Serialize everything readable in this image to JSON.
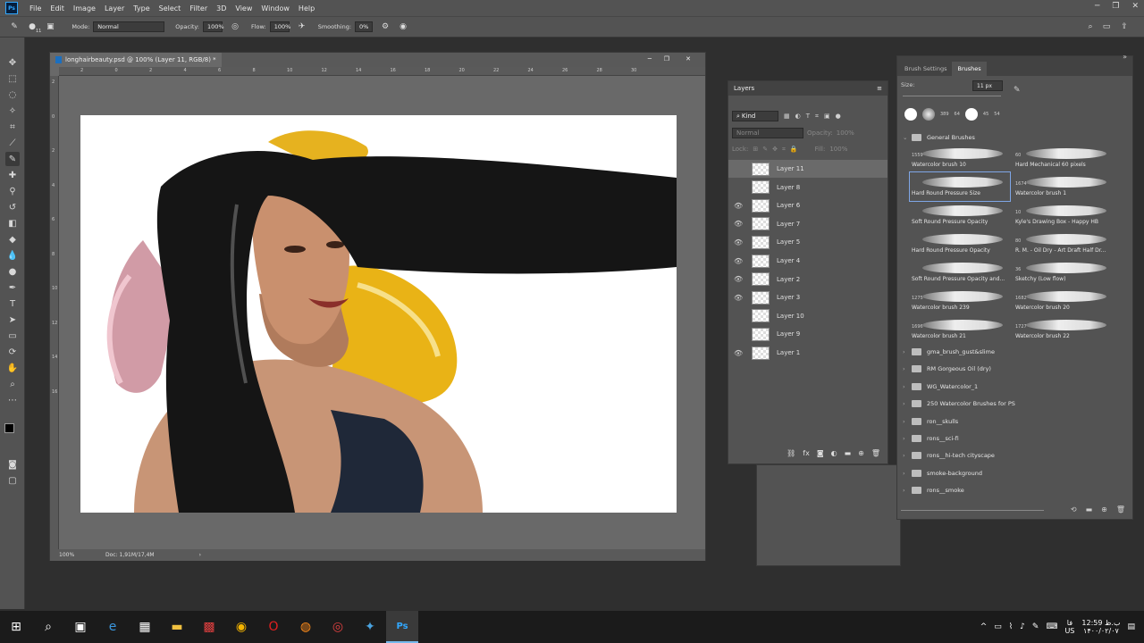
{
  "menu": [
    "File",
    "Edit",
    "Image",
    "Layer",
    "Type",
    "Select",
    "Filter",
    "3D",
    "View",
    "Window",
    "Help"
  ],
  "options": {
    "mode_label": "Mode:",
    "mode_value": "Normal",
    "opacity_label": "Opacity:",
    "opacity_value": "100%",
    "flow_label": "Flow:",
    "flow_value": "100%",
    "smoothing_label": "Smoothing:",
    "smoothing_value": "0%",
    "brush_size": "11"
  },
  "document": {
    "title": "longhairbeauty.psd @ 100% (Layer 11, RGB/8) *",
    "zoom": "100%",
    "doc_info": "Doc: 1,91M/17,4M",
    "ruler_h": [
      "2",
      "0",
      "2",
      "4",
      "6",
      "8",
      "10",
      "12",
      "14",
      "16",
      "18",
      "20",
      "22",
      "24",
      "26",
      "28",
      "30"
    ],
    "ruler_v": [
      "2",
      "0",
      "2",
      "4",
      "6",
      "8",
      "10",
      "12",
      "14",
      "16"
    ]
  },
  "layers": {
    "title": "Layers",
    "filter_kind": "Kind",
    "blend": "Normal",
    "opacity_label": "Opacity:",
    "opacity_value": "100%",
    "lock_label": "Lock:",
    "fill_label": "Fill:",
    "fill_value": "100%",
    "items": [
      {
        "name": "Layer 11",
        "visible": false,
        "selected": true
      },
      {
        "name": "Layer 8",
        "visible": false,
        "selected": false
      },
      {
        "name": "Layer 6",
        "visible": true,
        "selected": false
      },
      {
        "name": "Layer 7",
        "visible": true,
        "selected": false
      },
      {
        "name": "Layer 5",
        "visible": true,
        "selected": false
      },
      {
        "name": "Layer 4",
        "visible": true,
        "selected": false
      },
      {
        "name": "Layer 2",
        "visible": true,
        "selected": false
      },
      {
        "name": "Layer 3",
        "visible": true,
        "selected": false
      },
      {
        "name": "Layer 10",
        "visible": false,
        "selected": false
      },
      {
        "name": "Layer 9",
        "visible": false,
        "selected": false
      },
      {
        "name": "Layer 1",
        "visible": true,
        "selected": false
      }
    ]
  },
  "brushes": {
    "tab_settings": "Brush Settings",
    "tab_brushes": "Brushes",
    "size_label": "Size:",
    "size_value": "11 px",
    "preset_sizes": [
      "389",
      "64",
      "45",
      "54"
    ],
    "group": "General Brushes",
    "items": [
      {
        "name": "Watercolor brush 10",
        "num": "1559"
      },
      {
        "name": "Hard Mechanical 60 pixels",
        "num": "60"
      },
      {
        "name": "Hard Round Pressure Size",
        "num": ""
      },
      {
        "name": "Watercolor brush 1",
        "num": "1674"
      },
      {
        "name": "Soft Round Pressure Opacity",
        "num": ""
      },
      {
        "name": "Kyle's Drawing Box - Happy HB",
        "num": "10"
      },
      {
        "name": "Hard Round Pressure Opacity",
        "num": ""
      },
      {
        "name": "R. M. - Oil Dry - Art Draft Half Dr...",
        "num": "80"
      },
      {
        "name": "Soft Round Pressure Opacity and...",
        "num": ""
      },
      {
        "name": "Sketchy (Low flow)",
        "num": "36"
      },
      {
        "name": "Watercolor brush 239",
        "num": "1275"
      },
      {
        "name": "Watercolor brush 20",
        "num": "1682"
      },
      {
        "name": "Watercolor brush 21",
        "num": "1696"
      },
      {
        "name": "Watercolor brush 22",
        "num": "1727"
      }
    ],
    "folders": [
      "gma_brush_gust&slime",
      "RM Gorgeous Oil (dry)",
      "WG_Watercolor_1",
      "250 Watercolor Brushes for PS",
      "ron__skulls",
      "rons__sci-fi",
      "rons__hi-tech cityscape",
      "smoke-background",
      "rons__smoke"
    ]
  },
  "taskbar": {
    "time": "12:59 ب.ظ",
    "date": "۱۴۰۰/۰۲/۰۷",
    "lang": "US",
    "lang_fa": "فا"
  }
}
